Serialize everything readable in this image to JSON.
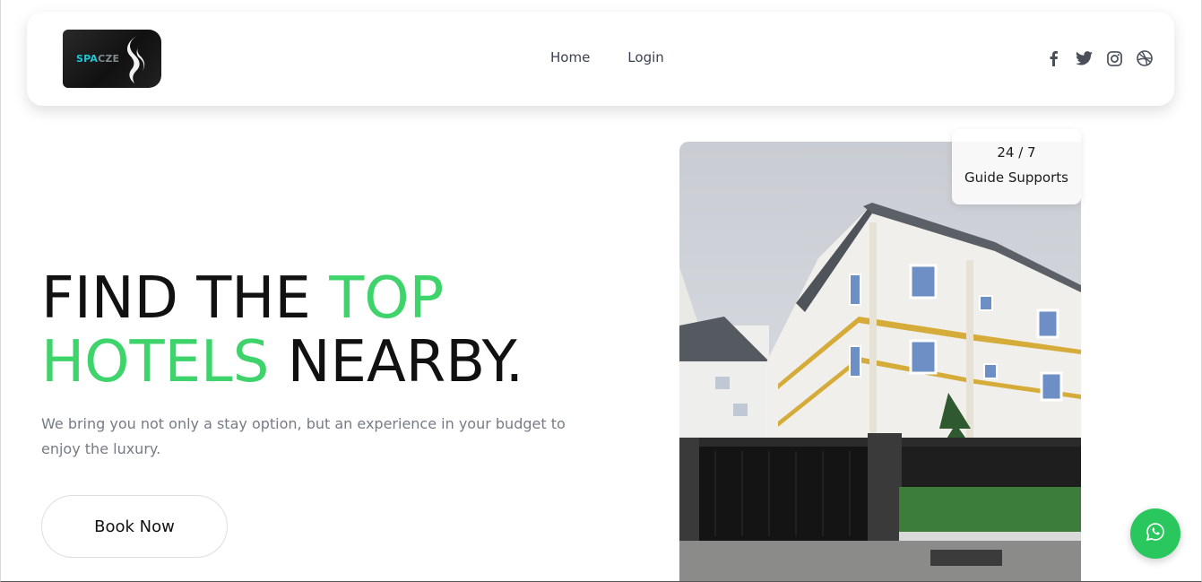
{
  "brand": {
    "logo_text_a": "SPA",
    "logo_text_b": "CZE",
    "logo_icon": "stylized-s-icon"
  },
  "nav": {
    "home": "Home",
    "login": "Login"
  },
  "socials": [
    {
      "icon": "facebook-icon"
    },
    {
      "icon": "twitter-icon"
    },
    {
      "icon": "instagram-icon"
    },
    {
      "icon": "dribbble-icon"
    }
  ],
  "hero": {
    "title_line1_plain": "FIND THE ",
    "title_line1_accent": "TOP",
    "title_line2_accent": "HOTELS",
    "title_line2_plain": " NEARBY.",
    "subtitle": "We bring you not only a stay option, but an experience in your budget to enjoy the luxury.",
    "cta": "Book Now"
  },
  "support": {
    "hours": "24 / 7",
    "label": "Guide Supports"
  },
  "colors": {
    "accent": "#3fd36b",
    "whatsapp": "#2ac75f"
  },
  "floating": {
    "icon": "whatsapp-icon"
  }
}
